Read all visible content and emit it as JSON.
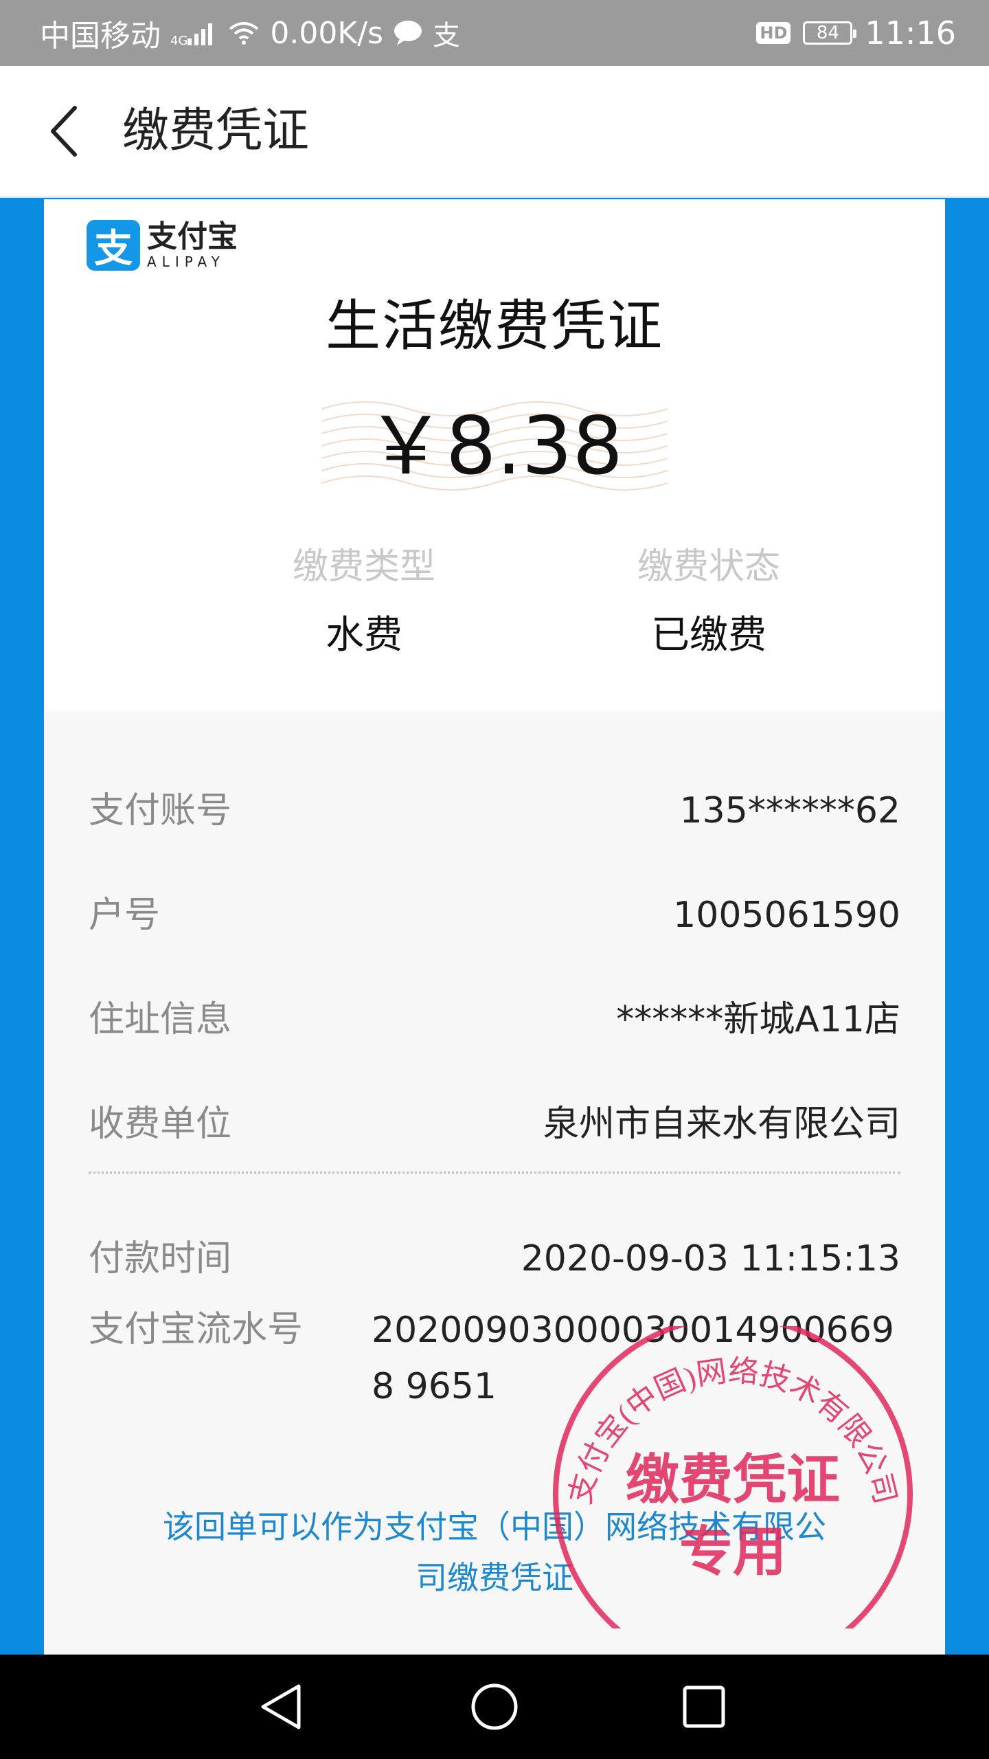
{
  "status_bar": {
    "carrier": "中国移动",
    "network": "4G",
    "speed": "0.00K/s",
    "hd": "HD",
    "battery": "84",
    "time": "11:16"
  },
  "nav": {
    "title": "缴费凭证"
  },
  "receipt": {
    "logo_cn": "支付宝",
    "logo_en": "ALIPAY",
    "title": "生活缴费凭证",
    "amount": "￥8.38",
    "type_label": "缴费类型",
    "type_value": "水费",
    "status_label": "缴费状态",
    "status_value": "已缴费",
    "rows": [
      {
        "label": "支付账号",
        "value": "135******62"
      },
      {
        "label": "户号",
        "value": "1005061590"
      },
      {
        "label": "住址信息",
        "value": "******新城A11店"
      },
      {
        "label": "收费单位",
        "value": "泉州市自来水有限公司"
      }
    ],
    "pay_time_label": "付款时间",
    "pay_time_value": "2020-09-03 11:15:13",
    "serial_label": "支付宝流水号",
    "serial_value": "202009030000300149006698 9651",
    "note": "该回单可以作为支付宝（中国）网络技术有限公司缴费凭证",
    "stamp_arc_text": "支付宝(中国)网络技术有限公司",
    "stamp_line1": "缴费凭证",
    "stamp_line2": "专用"
  },
  "colors": {
    "accent_blue": "#0a8ce0",
    "stamp_red": "#e0285a",
    "note_blue": "#1e88cf"
  }
}
